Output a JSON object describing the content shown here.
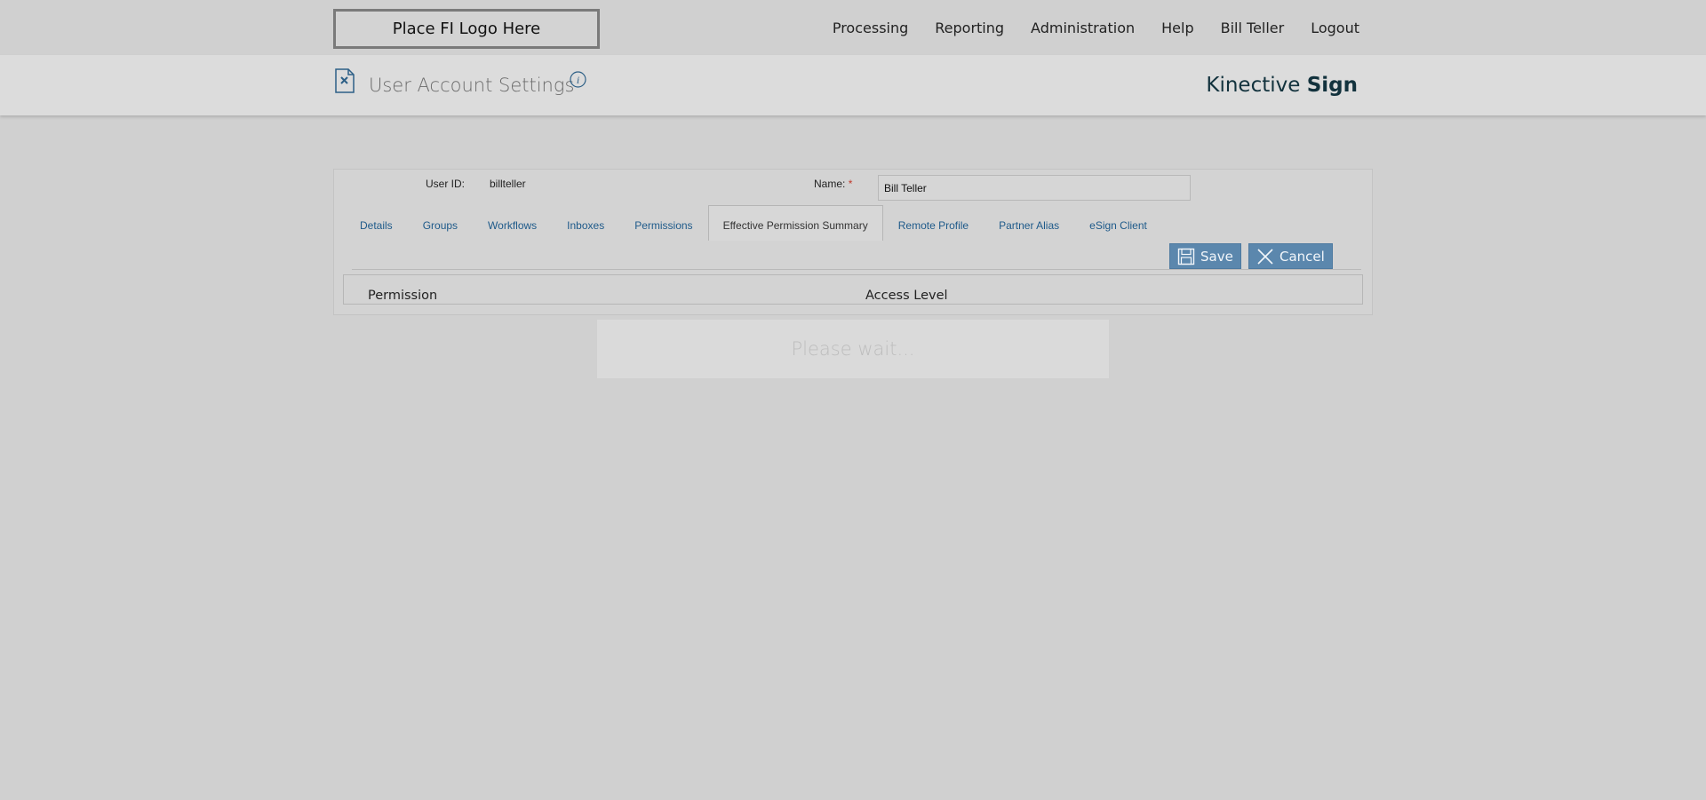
{
  "header": {
    "logo_text": "Place FI Logo Here",
    "nav": [
      {
        "label": "Processing"
      },
      {
        "label": "Reporting"
      },
      {
        "label": "Administration"
      },
      {
        "label": "Help"
      },
      {
        "label": "Bill Teller"
      },
      {
        "label": "Logout"
      }
    ]
  },
  "subheader": {
    "page_icon": "document-x-icon",
    "title": "User Account Settings",
    "info_icon": "info-icon",
    "brand_regular": "Kinective ",
    "brand_bold": "Sign"
  },
  "form": {
    "user_id_label": "User ID:",
    "user_id_value": "billteller",
    "name_label": "Name:",
    "name_required": "*",
    "name_value": "Bill Teller"
  },
  "tabs": [
    {
      "label": "Details",
      "active": false
    },
    {
      "label": "Groups",
      "active": false
    },
    {
      "label": "Workflows",
      "active": false
    },
    {
      "label": "Inboxes",
      "active": false
    },
    {
      "label": "Permissions",
      "active": false
    },
    {
      "label": "Effective Permission Summary",
      "active": true
    },
    {
      "label": "Remote Profile",
      "active": false
    },
    {
      "label": "Partner Alias",
      "active": false
    },
    {
      "label": "eSign Client",
      "active": false
    }
  ],
  "actions": {
    "save_label": "Save",
    "save_icon": "floppy-disk-icon",
    "cancel_label": "Cancel",
    "cancel_icon": "x-icon"
  },
  "grid": {
    "columns": [
      "Permission",
      "Access Level"
    ]
  },
  "overlay": {
    "text": "Please wait..."
  },
  "colors": {
    "background": "#d0d0d0",
    "link": "#1e5a8a",
    "button": "#5b87ad",
    "brand": "#12323d",
    "required": "#c0392b"
  }
}
